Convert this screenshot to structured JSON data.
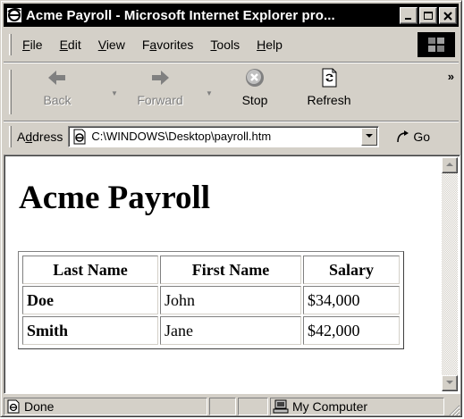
{
  "window": {
    "title": "Acme Payroll - Microsoft Internet Explorer pro...",
    "icon": "ie-icon",
    "caption_buttons": [
      "minimize-icon",
      "maximize-icon",
      "close-icon"
    ]
  },
  "menubar": {
    "items": [
      {
        "key": "F",
        "rest": "ile"
      },
      {
        "key": "E",
        "rest": "dit"
      },
      {
        "key": "V",
        "rest": "iew"
      },
      {
        "pre": "F",
        "key": "a",
        "rest": "vorites"
      },
      {
        "key": "T",
        "rest": "ools"
      },
      {
        "key": "H",
        "rest": "elp"
      }
    ],
    "throbber_icon": "windows-logo-icon"
  },
  "toolbar": {
    "back_label": "Back",
    "forward_label": "Forward",
    "stop_label": "Stop",
    "refresh_label": "Refresh",
    "more_chevron": "»"
  },
  "addressbar": {
    "label_pre": "A",
    "label_key": "d",
    "label_rest": "dress",
    "value": "C:\\WINDOWS\\Desktop\\payroll.htm",
    "go_label": "Go"
  },
  "page": {
    "title": "Acme Payroll",
    "table": {
      "headers": [
        "Last Name",
        "First Name",
        "Salary"
      ],
      "rows": [
        [
          "Doe",
          "John",
          "$34,000"
        ],
        [
          "Smith",
          "Jane",
          "$42,000"
        ]
      ]
    }
  },
  "statusbar": {
    "status": "Done",
    "zone": "My Computer"
  },
  "colors": {
    "titlebar_bg": "#000000",
    "chrome_face": "#d4d0c8"
  }
}
